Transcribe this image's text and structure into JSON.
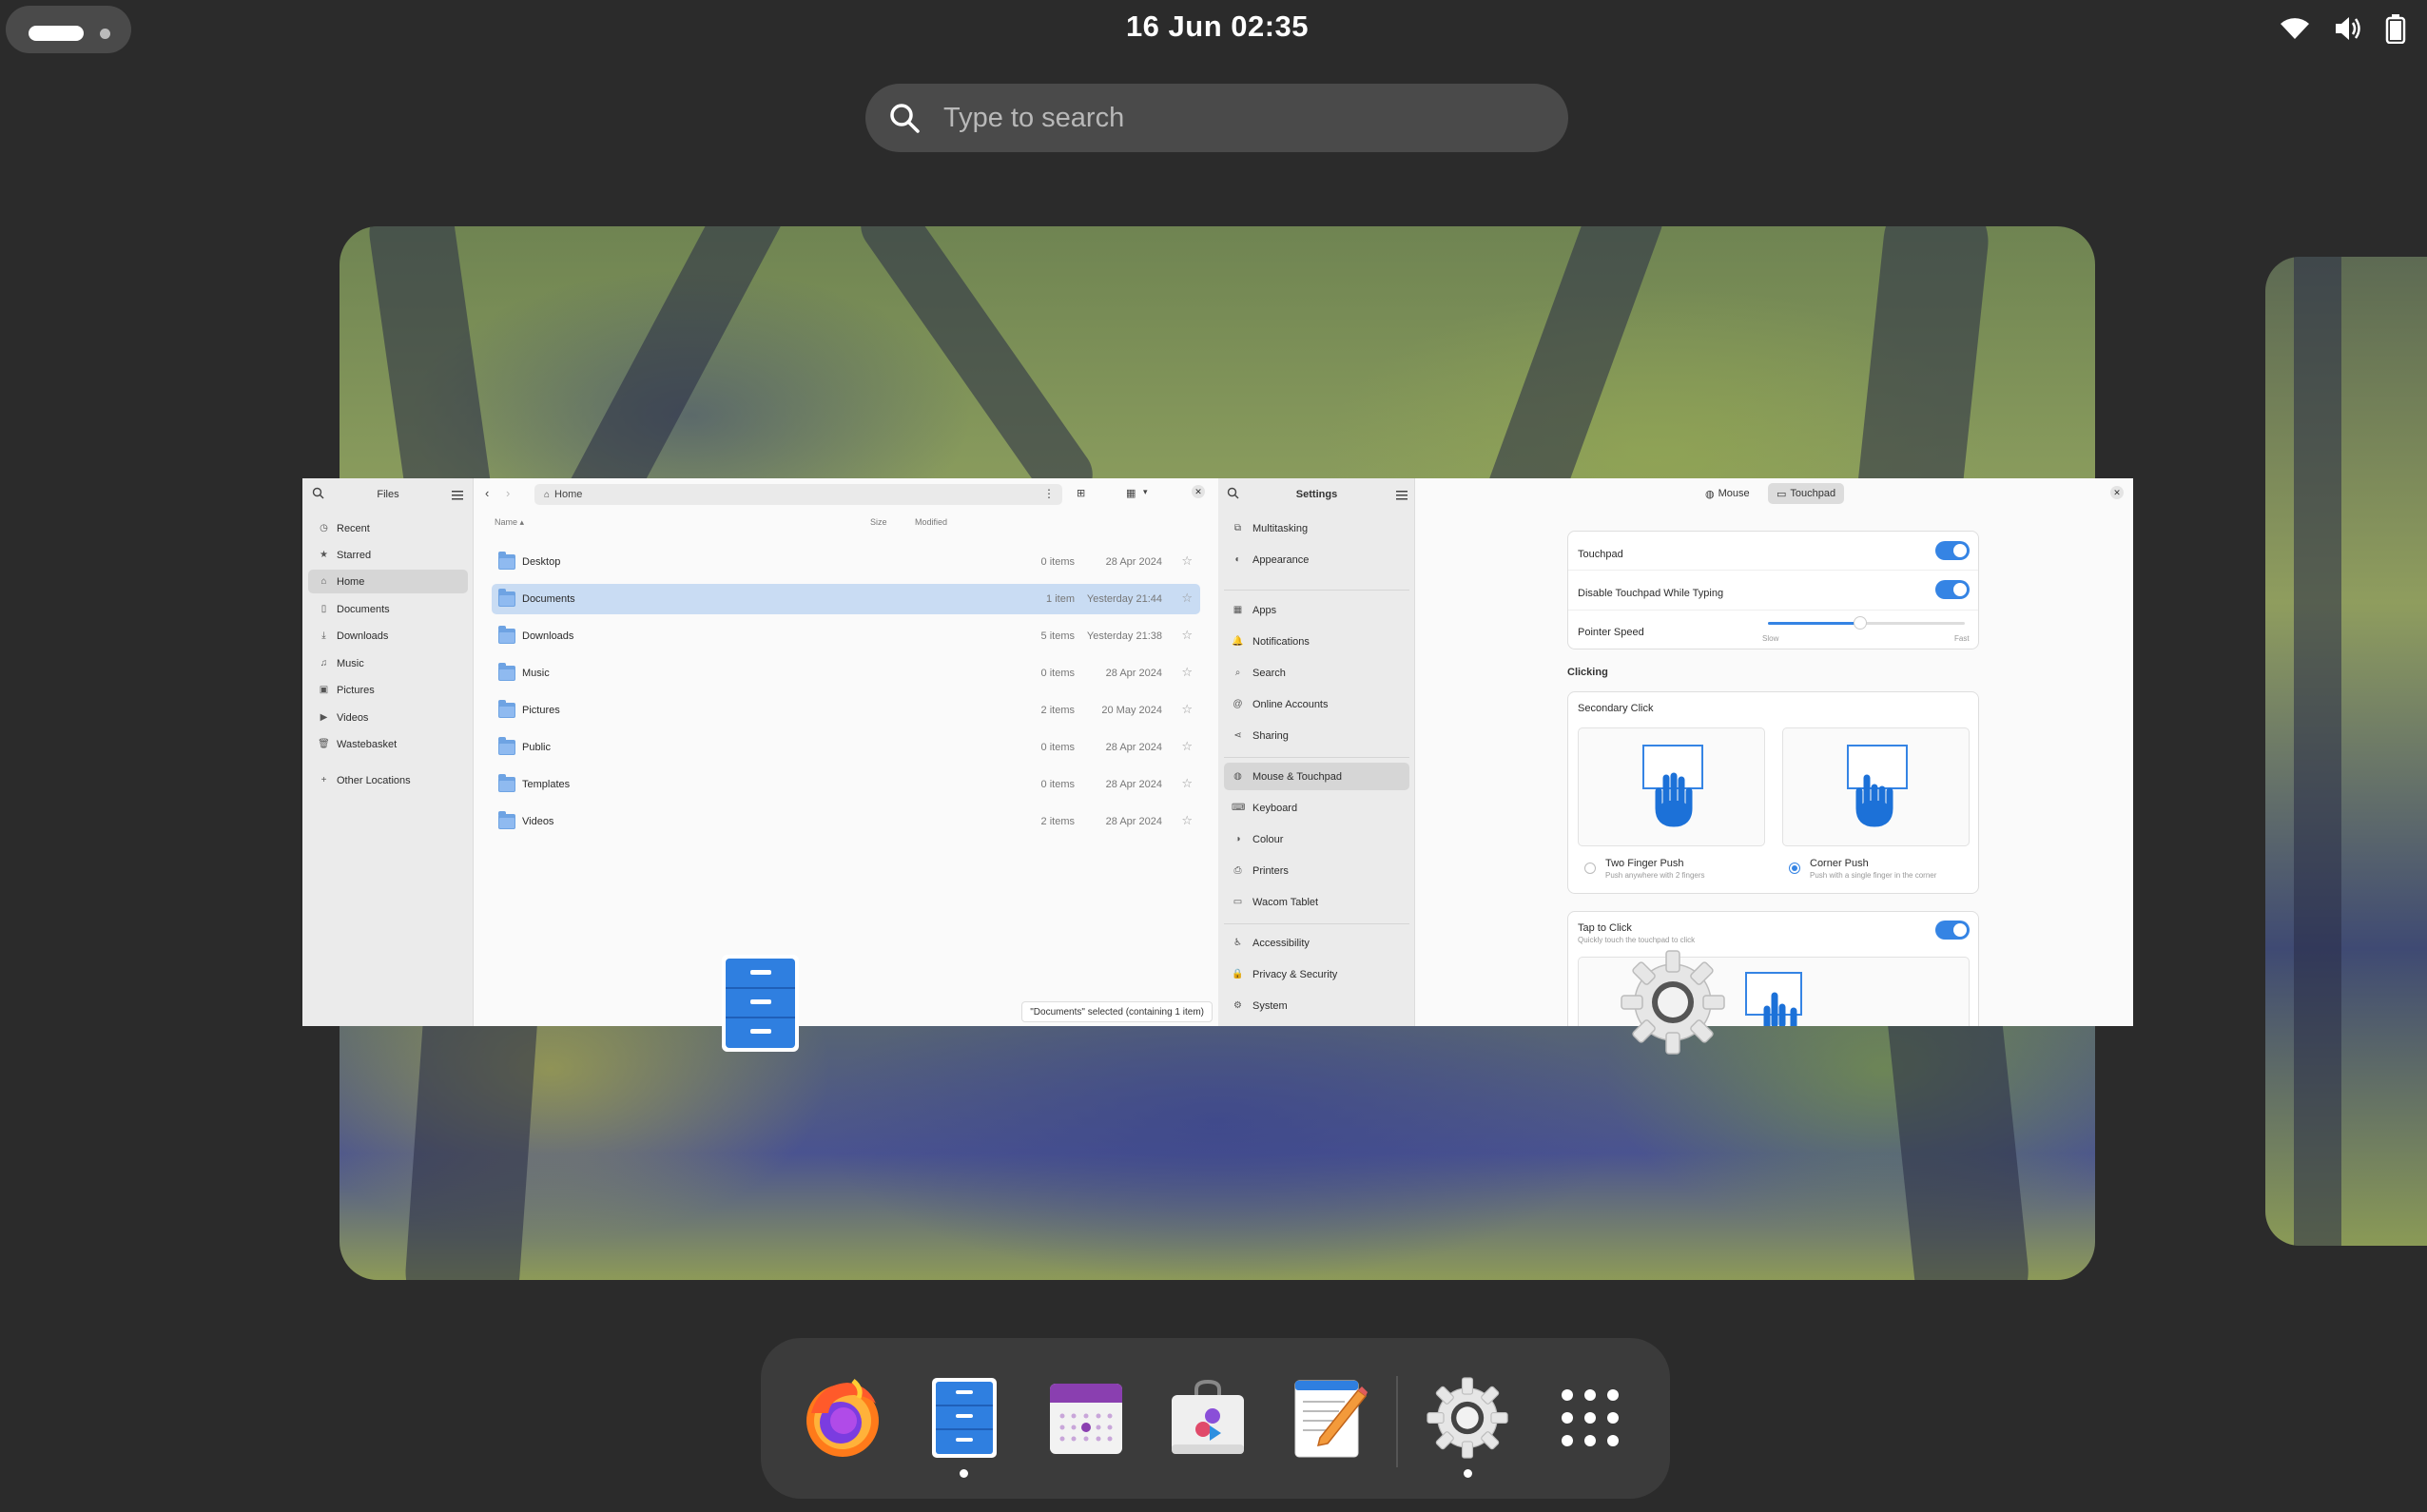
{
  "topbar": {
    "clock": "16 Jun  02:35",
    "tray_icons": [
      "wifi-icon",
      "volume-icon",
      "battery-icon"
    ]
  },
  "search": {
    "placeholder": "Type to search"
  },
  "files": {
    "sidebar_title": "Files",
    "sidebar_items": [
      {
        "label": "Recent",
        "icon": "clock-icon"
      },
      {
        "label": "Starred",
        "icon": "star-icon"
      },
      {
        "label": "Home",
        "icon": "home-icon"
      },
      {
        "label": "Documents",
        "icon": "document-icon"
      },
      {
        "label": "Downloads",
        "icon": "download-icon"
      },
      {
        "label": "Music",
        "icon": "music-icon"
      },
      {
        "label": "Pictures",
        "icon": "picture-icon"
      },
      {
        "label": "Videos",
        "icon": "video-icon"
      },
      {
        "label": "Wastebasket",
        "icon": "trash-icon"
      },
      {
        "label": "Other Locations",
        "icon": "plus-icon"
      }
    ],
    "path": "Home",
    "columns": {
      "name": "Name",
      "size": "Size",
      "modified": "Modified"
    },
    "rows": [
      {
        "name": "Desktop",
        "size": "0 items",
        "modified": "28 Apr 2024"
      },
      {
        "name": "Documents",
        "size": "1 item",
        "modified": "Yesterday 21:44"
      },
      {
        "name": "Downloads",
        "size": "5 items",
        "modified": "Yesterday 21:38"
      },
      {
        "name": "Music",
        "size": "0 items",
        "modified": "28 Apr 2024"
      },
      {
        "name": "Pictures",
        "size": "2 items",
        "modified": "20 May 2024"
      },
      {
        "name": "Public",
        "size": "0 items",
        "modified": "28 Apr 2024"
      },
      {
        "name": "Templates",
        "size": "0 items",
        "modified": "28 Apr 2024"
      },
      {
        "name": "Videos",
        "size": "2 items",
        "modified": "28 Apr 2024"
      }
    ],
    "selected_row": "Documents",
    "status": "\"Documents\" selected  (containing 1 item)"
  },
  "settings": {
    "sidebar_title": "Settings",
    "sidebar_items": [
      {
        "label": "Multitasking",
        "icon": "multitasking-icon"
      },
      {
        "label": "Appearance",
        "icon": "appearance-icon"
      },
      {
        "label": "Apps",
        "icon": "apps-icon"
      },
      {
        "label": "Notifications",
        "icon": "bell-icon"
      },
      {
        "label": "Search",
        "icon": "search-icon"
      },
      {
        "label": "Online Accounts",
        "icon": "at-icon"
      },
      {
        "label": "Sharing",
        "icon": "share-icon"
      },
      {
        "label": "Mouse & Touchpad",
        "icon": "mouse-icon"
      },
      {
        "label": "Keyboard",
        "icon": "keyboard-icon"
      },
      {
        "label": "Colour",
        "icon": "colour-icon"
      },
      {
        "label": "Printers",
        "icon": "printer-icon"
      },
      {
        "label": "Wacom Tablet",
        "icon": "tablet-icon"
      },
      {
        "label": "Accessibility",
        "icon": "accessibility-icon"
      },
      {
        "label": "Privacy & Security",
        "icon": "lock-icon"
      },
      {
        "label": "System",
        "icon": "system-icon"
      }
    ],
    "active_item": "Mouse & Touchpad",
    "tabs": [
      {
        "label": "Mouse"
      },
      {
        "label": "Touchpad"
      }
    ],
    "active_tab": "Touchpad",
    "touchpad_label": "Touchpad",
    "touchpad_on": true,
    "disable_typing_label": "Disable Touchpad While Typing",
    "disable_typing_on": true,
    "pointer_speed_label": "Pointer Speed",
    "pointer_speed_value": 0.47,
    "slow_label": "Slow",
    "fast_label": "Fast",
    "clicking_heading": "Clicking",
    "secondary_click_label": "Secondary Click",
    "two_finger_label": "Two Finger Push",
    "two_finger_sub": "Push anywhere with 2 fingers",
    "corner_label": "Corner Push",
    "corner_sub": "Push with a single finger in the corner",
    "secondary_selected": "Corner Push",
    "tap_label": "Tap to Click",
    "tap_sub": "Quickly touch the touchpad to click",
    "tap_on": true
  },
  "dock": {
    "apps": [
      {
        "name": "Firefox"
      },
      {
        "name": "Files",
        "running": true
      },
      {
        "name": "Calendar"
      },
      {
        "name": "Software"
      },
      {
        "name": "Text Editor"
      },
      {
        "name": "Settings",
        "running": true
      },
      {
        "name": "Show Apps"
      }
    ]
  },
  "colors": {
    "accent": "#3584e4",
    "panel": "#2b2b2b",
    "selection": "#c9dcf3"
  }
}
